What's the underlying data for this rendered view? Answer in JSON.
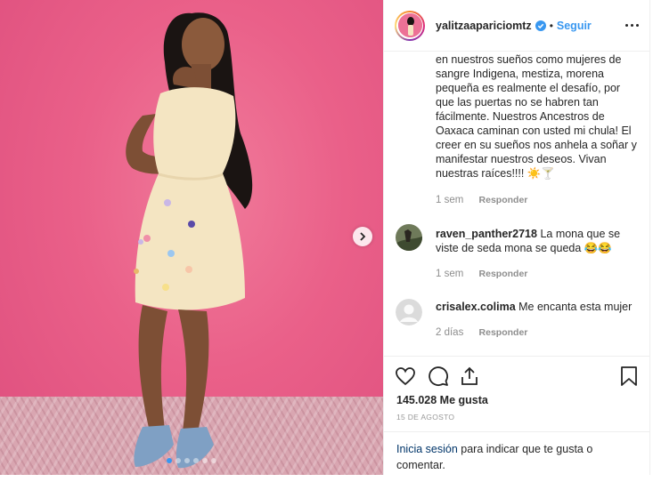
{
  "post": {
    "username": "yalitzaapariciomtz",
    "separator": "•",
    "follow_label": "Seguir",
    "verified_icon": "verified-badge-icon",
    "carousel": {
      "dots": 6,
      "active_index": 0
    }
  },
  "caption": {
    "text": "en nuestros sueños como mujeres de sangre Indigena, mestiza, morena pequeña es realmente el desafío, por que las puertas no se habren tan fácilmente. Nuestros Ancestros de Oaxaca caminan con usted mi chula! El creer en su sueños nos anhela a soñar y manifestar nuestros deseos. Vivan nuestras raíces!!!! ☀️🍸",
    "time": "1 sem",
    "reply_label": "Responder"
  },
  "comments": [
    {
      "user": "raven_panther2718",
      "text": "La mona que se viste de seda mona se queda 😂😂",
      "time": "1 sem",
      "reply_label": "Responder"
    },
    {
      "user": "crisalex.colima",
      "text": "Me encanta esta mujer",
      "time": "2 días",
      "reply_label": "Responder"
    }
  ],
  "actions": {
    "likes": "145.028 Me gusta",
    "date": "15 DE AGOSTO",
    "login_link": "Inicia sesión",
    "login_text": "para indicar que te gusta o comentar."
  },
  "colors": {
    "accent_blue": "#3897f0",
    "photo_background": "#e8628a",
    "text": "#262626",
    "muted": "#8e8e8e"
  }
}
